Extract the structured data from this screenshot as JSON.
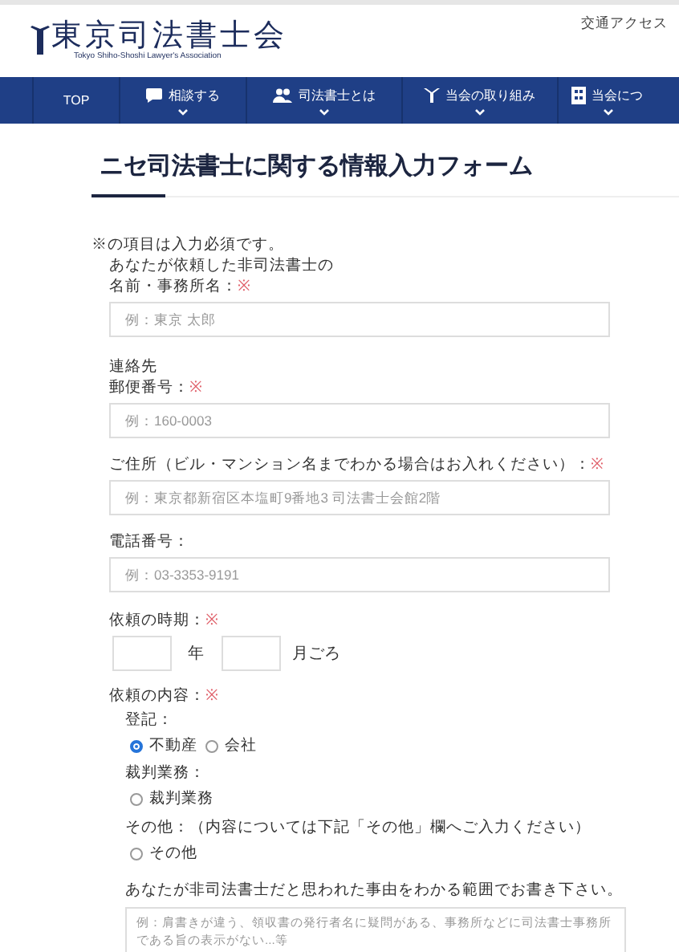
{
  "header": {
    "logo_title": "東京司法書士会",
    "logo_subtitle": "Tokyo Shiho-Shoshi Lawyer's Association",
    "top_link": "交通アクセス"
  },
  "nav": [
    {
      "label": "TOP"
    },
    {
      "label": "相談する"
    },
    {
      "label": "司法書士とは"
    },
    {
      "label": "当会の取り組み"
    },
    {
      "label": "当会につ"
    }
  ],
  "form": {
    "title": "ニセ司法書士に関する情報入力フォーム",
    "required_mark": "※",
    "required_note": "※の項目は入力必須です。",
    "fields": [
      {
        "kind": "text",
        "label_lines": [
          "あなたが依頼した非司法書士の",
          "名前・事務所名："
        ],
        "required": true,
        "placeholder": "例：東京 太郎"
      },
      {
        "kind": "text",
        "label_lines": [
          "連絡先",
          "郵便番号："
        ],
        "required": true,
        "placeholder": "例：160-0003"
      },
      {
        "kind": "text",
        "label_lines": [
          "ご住所（ビル・マンション名までわかる場合はお入れください）："
        ],
        "required": true,
        "placeholder": "例：東京都新宿区本塩町9番地3 司法書士会館2階"
      },
      {
        "kind": "text",
        "label_lines": [
          "電話番号："
        ],
        "required": false,
        "placeholder": "例：03-3353-9191"
      },
      {
        "kind": "date",
        "label_lines": [
          "依頼の時期："
        ],
        "required": true,
        "units": [
          "年",
          "月ごろ"
        ]
      },
      {
        "kind": "choices",
        "label_lines": [
          "依頼の内容："
        ],
        "required": true,
        "groups": [
          {
            "label": "登記：",
            "options": [
              {
                "label": "不動産",
                "selected": true
              },
              {
                "label": "会社",
                "selected": false
              }
            ]
          },
          {
            "label": "裁判業務：",
            "options": [
              {
                "label": "裁判業務",
                "selected": false
              }
            ]
          },
          {
            "label": "その他：（内容については下記「その他」欄へご入力ください）",
            "options": [
              {
                "label": "その他",
                "selected": false
              }
            ]
          }
        ]
      },
      {
        "kind": "textarea",
        "label_lines": [
          "あなたが非司法書士だと思われた事由をわかる範囲でお書き下さい。"
        ],
        "required": false,
        "placeholder": "例：肩書きが違う、領収書の発行者名に疑問がある、事務所などに司法書士事務所である旨の表示がない...等"
      }
    ]
  }
}
